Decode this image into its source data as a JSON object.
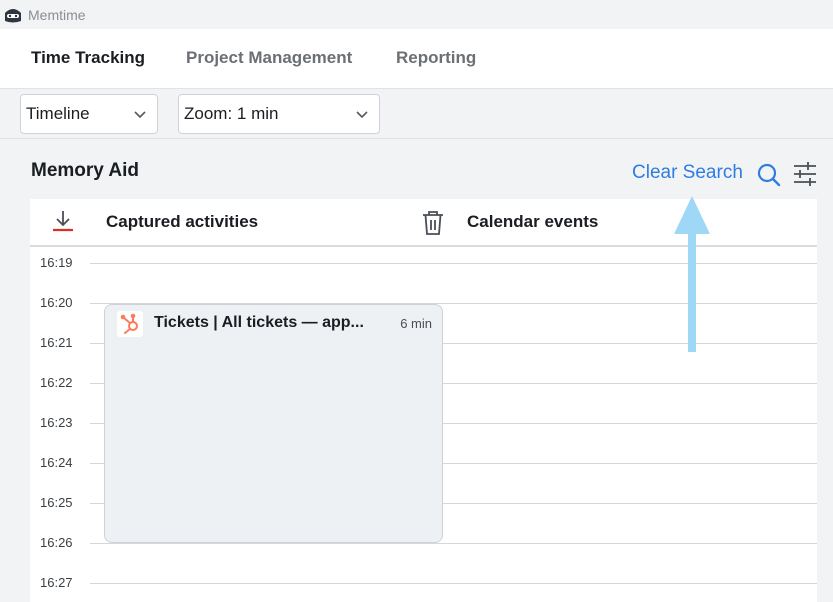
{
  "app": {
    "title": "Memtime",
    "logo_icon": "memtime-logo-icon"
  },
  "nav": {
    "tabs": [
      {
        "label": "Time Tracking",
        "active": true
      },
      {
        "label": "Project Management",
        "active": false
      },
      {
        "label": "Reporting",
        "active": false
      }
    ]
  },
  "toolbar": {
    "view_select": {
      "value": "Timeline"
    },
    "zoom_select": {
      "value": "Zoom: 1 min"
    }
  },
  "memory_aid": {
    "title": "Memory Aid",
    "clear_search_label": "Clear Search",
    "columns": {
      "captured": "Captured activities",
      "calendar": "Calendar events"
    },
    "times": [
      "16:19",
      "16:20",
      "16:21",
      "16:22",
      "16:23",
      "16:24",
      "16:25",
      "16:26",
      "16:27"
    ],
    "activity": {
      "title": "Tickets | All tickets — app...",
      "duration": "6 min",
      "icon": "hubspot-icon",
      "icon_color": "#ff7a59"
    }
  },
  "colors": {
    "accent": "#2f7de1",
    "download_underline": "#d93025",
    "annotation_arrow": "#9fd8f7"
  }
}
